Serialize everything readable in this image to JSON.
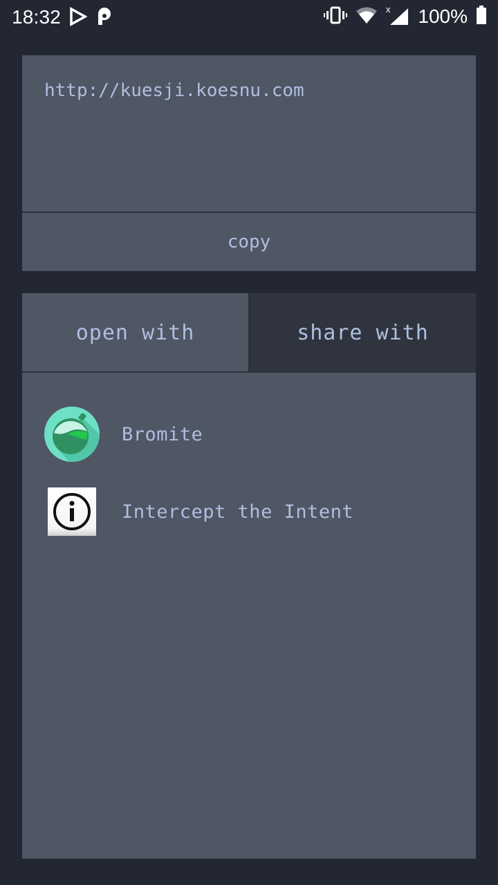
{
  "status_bar": {
    "time": "18:32",
    "left_icons": [
      "play-store-icon",
      "p-app-icon"
    ],
    "right_icons": [
      "vibrate-icon",
      "wifi-icon",
      "signal-no-data-icon",
      "battery-icon"
    ],
    "battery_percent": "100%"
  },
  "url_box": {
    "value": "http://kuesji.koesnu.com"
  },
  "copy_button": {
    "label": "copy"
  },
  "tabs": [
    {
      "label": "open with",
      "active": true
    },
    {
      "label": "share with",
      "active": false
    }
  ],
  "apps": [
    {
      "name": "Bromite",
      "icon": "bromite-icon"
    },
    {
      "name": "Intercept the Intent",
      "icon": "info-icon"
    }
  ],
  "colors": {
    "background": "#232733",
    "panel": "#4f5664",
    "inactive_tab": "#2f343e",
    "text": "#aebfe0"
  }
}
